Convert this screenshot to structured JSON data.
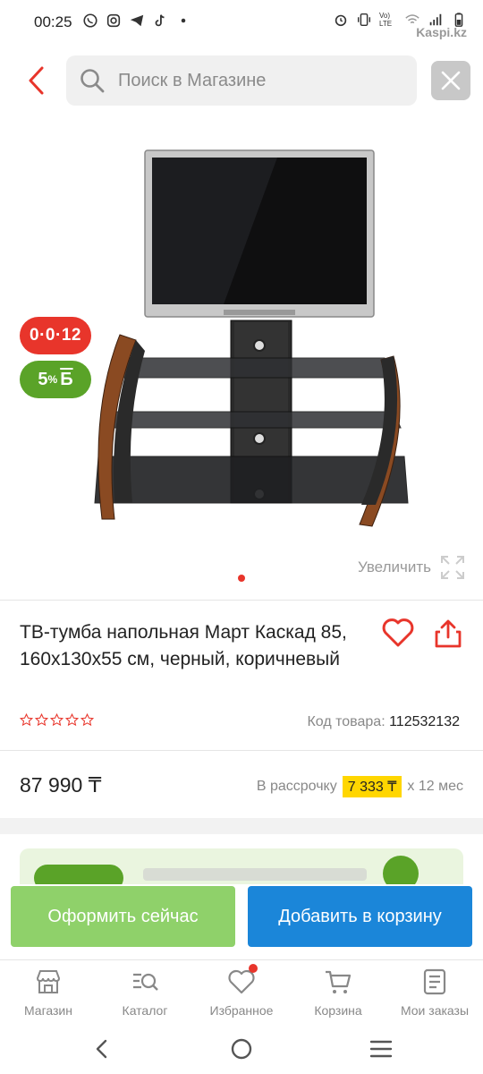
{
  "status_bar": {
    "time": "00:25",
    "watermark": "Kaspi.kz",
    "network_label": "Vo) LTE"
  },
  "header": {
    "search_placeholder": "Поиск в Магазине"
  },
  "colors": {
    "accent_red": "#e8352b",
    "bonus_green": "#5aa328",
    "checkout_green": "#8fd16a",
    "cart_blue": "#1b86d9",
    "installment_yellow": "#ffd600"
  },
  "product": {
    "badge_credit": "0·0·12",
    "badge_bonus_percent": "5",
    "badge_bonus_sup": "%",
    "badge_bonus_symbol": "Б",
    "zoom_label": "Увеличить",
    "title": "ТВ-тумба напольная Март Каскад 85, 160x130x55 см, черный, коричневый",
    "rating": 0,
    "rating_max": 5,
    "sku_label": "Код товара:",
    "sku_value": "112532132",
    "price": "87 990 ₸",
    "installment_prefix": "В рассрочку",
    "installment_amount": "7 333 ₸",
    "installment_suffix": "х 12 мес"
  },
  "actions": {
    "checkout_label": "Оформить сейчас",
    "cart_label": "Добавить в корзину"
  },
  "bottom_nav": {
    "items": [
      {
        "label": "Магазин",
        "icon": "shop-icon"
      },
      {
        "label": "Каталог",
        "icon": "catalog-search-icon"
      },
      {
        "label": "Избранное",
        "icon": "heart-icon"
      },
      {
        "label": "Корзина",
        "icon": "cart-icon"
      },
      {
        "label": "Мои заказы",
        "icon": "orders-icon"
      }
    ]
  }
}
